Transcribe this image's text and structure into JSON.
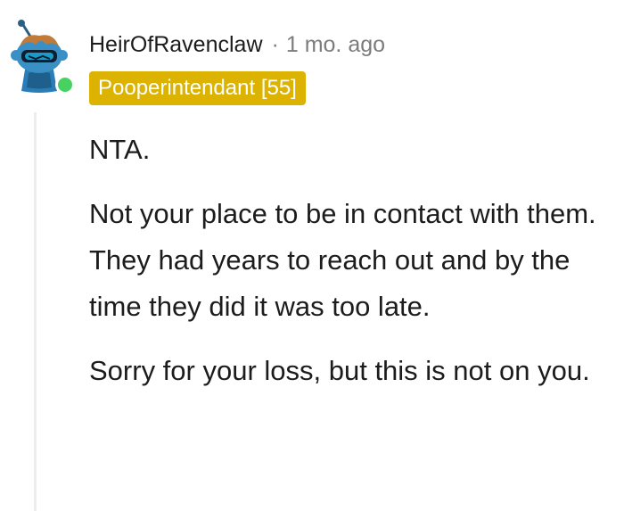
{
  "comment": {
    "author": "HeirOfRavenclaw",
    "separator": "·",
    "timestamp": "1 mo. ago",
    "flair": "Pooperintendant [55]",
    "online": true,
    "avatar_icon": "snoo-avatar-icon",
    "paragraphs": [
      "NTA.",
      "Not your place to be in contact with them. They had years to reach out and by the time they did it was too late.",
      "Sorry for your loss, but this is not on you."
    ]
  },
  "colors": {
    "flair_background": "#dbb300",
    "online_indicator": "#46d160",
    "meta_gray": "#7c7c7c",
    "thread_line": "#ededed"
  }
}
